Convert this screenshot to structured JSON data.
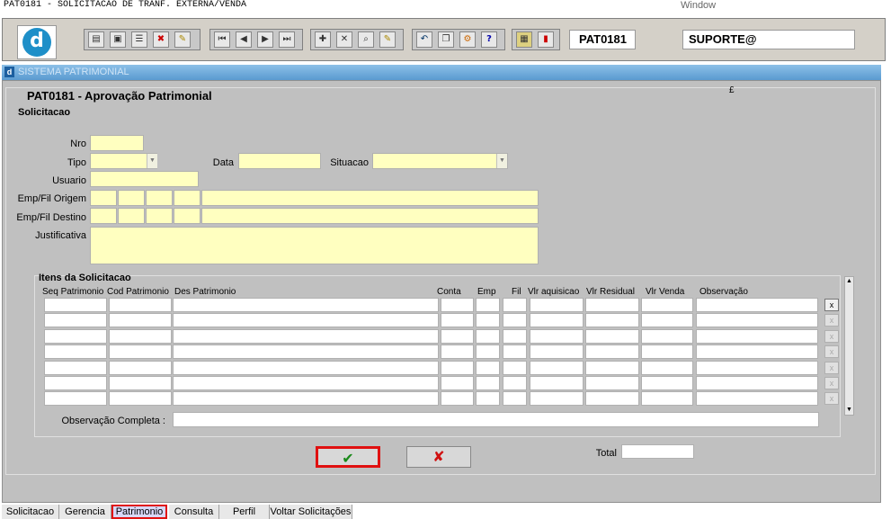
{
  "window": {
    "title": "PAT0181 - SOLICITACAO DE TRANF. EXTERNA/VENDA",
    "menu_label": "Window"
  },
  "toolbar": {
    "logo_letter": "d",
    "form_code": "PAT0181",
    "user": "SUPORTE@",
    "icons": [
      "save-icon",
      "window-icon",
      "print-icon",
      "delete-icon",
      "edit-icon",
      "first-record-icon",
      "prev-record-icon",
      "next-record-icon",
      "last-record-icon",
      "insert-icon",
      "remove-icon",
      "query-icon",
      "clear-icon",
      "undo-icon",
      "copy-icon",
      "settings-icon",
      "help-icon",
      "report-icon",
      "exit-icon"
    ]
  },
  "system": {
    "header": "SISTEMA PATRIMONIAL"
  },
  "form": {
    "title": "PAT0181 - Aprovação Patrimonial",
    "pound_mark": "£",
    "section": "Solicitacao",
    "labels": {
      "nro": "Nro",
      "tipo": "Tipo",
      "data": "Data",
      "situacao": "Situacao",
      "usuario": "Usuario",
      "origem": "Emp/Fil Origem",
      "destino": "Emp/Fil Destino",
      "justificativa": "Justificativa"
    },
    "values": {
      "nro": "",
      "tipo": "",
      "data": "",
      "situacao": "",
      "usuario": "",
      "justificativa": ""
    }
  },
  "items": {
    "title": "Itens da Solicitacao",
    "columns": [
      "Seq Patrimonio",
      "Cod Patrimonio",
      "Des Patrimonio",
      "Conta",
      "Emp",
      "Fil",
      "Vlr aquisicao",
      "Vlr Residual",
      "Vlr Venda",
      "Observação"
    ],
    "delete_label": "x",
    "obs_label": "Observação Completa :",
    "obs_value": ""
  },
  "actions": {
    "confirm_icon": "✔",
    "cancel_icon": "✘",
    "total_label": "Total",
    "total_value": ""
  },
  "tabs": [
    "Solicitacao",
    "Gerencia",
    "Patrimonio",
    "Consulta",
    "Perfil",
    "Voltar Solicitações"
  ],
  "colors": {
    "field_yellow": "#ffffc0",
    "panel_gray": "#c0c0c0",
    "header_blue": "#5a9ad0",
    "confirm_green": "#1a8a1a",
    "cancel_red": "#d01010",
    "highlight_red": "#e01010"
  }
}
